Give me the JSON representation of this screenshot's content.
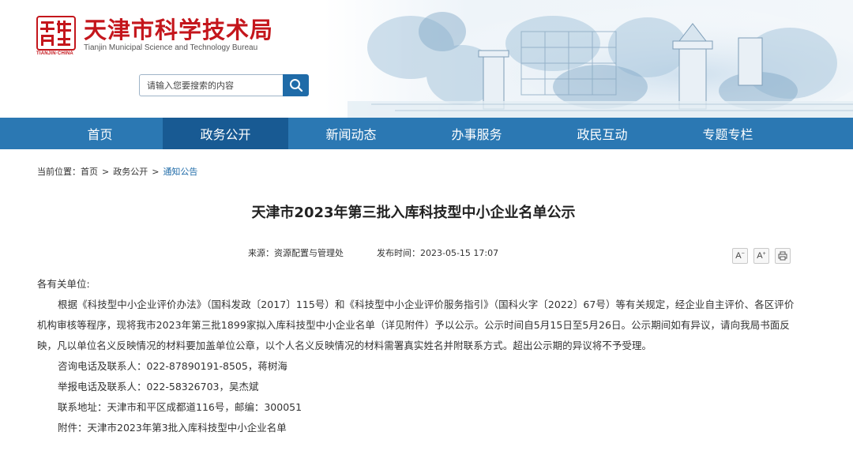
{
  "header": {
    "site_title": "天津市科学技术局",
    "site_subtitle": "Tianjin Municipal Science and Technology Bureau",
    "seal_caption": "TIANJIN·CHINA",
    "search_placeholder": "请输入您要搜索的内容",
    "search_icon": "search-icon"
  },
  "nav": {
    "items": [
      {
        "label": "首页"
      },
      {
        "label": "政务公开"
      },
      {
        "label": "新闻动态"
      },
      {
        "label": "办事服务"
      },
      {
        "label": "政民互动"
      },
      {
        "label": "专题专栏"
      }
    ],
    "active_index": 1
  },
  "breadcrumb": {
    "prefix": "当前位置：",
    "items": [
      "首页",
      "政务公开",
      "通知公告"
    ],
    "separator": ">"
  },
  "article": {
    "title": "天津市2023年第三批入库科技型中小企业名单公示",
    "source": "来源：资源配置与管理处",
    "published": "发布时间：2023-05-15 17:07",
    "tools": {
      "font_decrease": "A",
      "font_increase": "A",
      "print_icon": "print-icon"
    },
    "salutation": "各有关单位:",
    "body": "根据《科技型中小企业评价办法》（国科发政〔2017〕115号）和《科技型中小企业评价服务指引》（国科火字〔2022〕67号）等有关规定，经企业自主评价、各区评价机构审核等程序，现将我市2023年第三批1899家拟入库科技型中小企业名单（详见附件）予以公示。公示时间自5月15日至5月26日。公示期间如有异议，请向我局书面反映，凡以单位名义反映情况的材料要加盖单位公章，以个人名义反映情况的材料需署真实姓名并附联系方式。超出公示期的异议将不予受理。",
    "consult": "咨询电话及联系人：022-87890191-8505，蒋树海",
    "report": "举报电话及联系人：022-58326703，吴杰斌",
    "address": "联系地址：天津市和平区成都道116号，邮编：300051",
    "attachment": "附件：天津市2023年第3批入库科技型中小企业名单"
  },
  "colors": {
    "brand_red": "#c4161c",
    "nav_blue": "#2b78b3",
    "nav_active": "#185a93",
    "link_blue": "#1f6ba8"
  }
}
